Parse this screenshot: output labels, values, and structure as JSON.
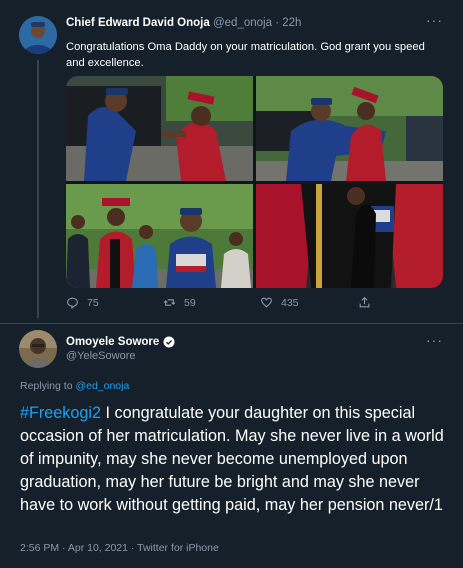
{
  "tweet1": {
    "author_name": "Chief Edward David Onoja",
    "handle": "@ed_onoja",
    "separator": "·",
    "time": "22h",
    "more_label": "···",
    "text": "Congratulations Oma Daddy on your matriculation. God grant you speed and excellence.",
    "media": [
      {
        "label": "handshake-photo"
      },
      {
        "label": "hug-photo"
      },
      {
        "label": "group-photo"
      },
      {
        "label": "closeup-photo"
      }
    ],
    "actions": {
      "reply_count": "75",
      "retweet_count": "59",
      "like_count": "435"
    },
    "icons": [
      "avatar",
      "reply-icon",
      "retweet-icon",
      "like-icon",
      "share-icon"
    ]
  },
  "tweet2": {
    "author_name": "Omoyele Sowore",
    "handle": "@YeleSowore",
    "more_label": "···",
    "replying_prefix": "Replying to",
    "replying_to": "@ed_onoja",
    "hashtag": "#Freekogi2",
    "text": " I congratulate your daughter on this special occasion of her matriculation. May she never live in a world of impunity, may she never become unemployed upon graduation, may her future be bright and may she never have to work without getting paid, may her pension never/1",
    "timestamp": "2:56 PM · Apr 10, 2021 · Twitter for iPhone",
    "icons": [
      "avatar",
      "verified-badge-icon"
    ]
  },
  "colors": {
    "background": "#15202b",
    "text": "#ffffff",
    "muted": "#8899a6",
    "link": "#1da1f2",
    "border": "#38444d"
  }
}
